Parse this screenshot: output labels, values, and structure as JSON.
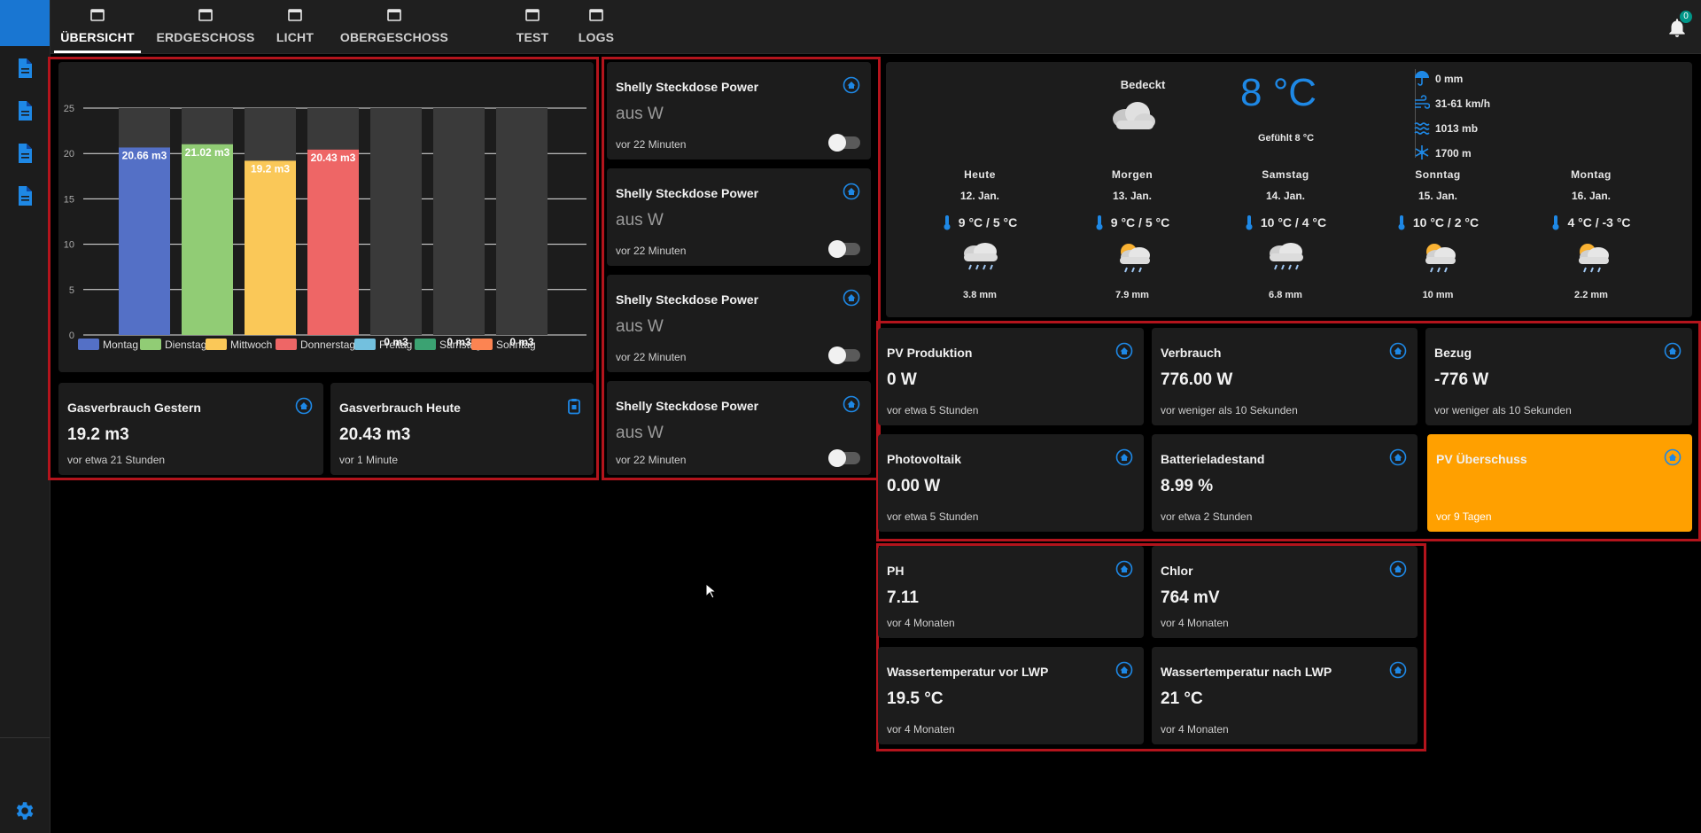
{
  "nav": {
    "tabs": [
      {
        "label": "ÜBERSICHT"
      },
      {
        "label": "ERDGESCHOSS"
      },
      {
        "label": "LICHT"
      },
      {
        "label": "OBERGESCHOSS"
      },
      {
        "label": "TEST"
      },
      {
        "label": "LOGS"
      }
    ],
    "notification_count": "0"
  },
  "colors": {
    "accent": "#1e88e5",
    "highlight_card": "#ffa000",
    "frame": "#b3141c"
  },
  "chart_data": {
    "type": "bar",
    "categories": [
      "Montag",
      "Dienstag",
      "Mittwoch",
      "Donnerstag",
      "Freitag",
      "Samstag",
      "Sonntag"
    ],
    "values": [
      20.66,
      21.02,
      19.2,
      20.43,
      0,
      0,
      0
    ],
    "data_labels": [
      "20.66 m3",
      "21.02 m3",
      "19.2 m3",
      "20.43 m3",
      "0 m3",
      "0 m3",
      "0 m3"
    ],
    "colors": [
      "#5470c6",
      "#91cc75",
      "#fac858",
      "#ee6666",
      "#73c0de",
      "#3ba272",
      "#fc8452"
    ],
    "yticks": [
      "0",
      "5",
      "10",
      "15",
      "20",
      "25"
    ],
    "ylim": [
      0,
      25
    ],
    "legend": [
      "Montag",
      "Dienstag",
      "Mittwoch",
      "Donnerstag",
      "Freitag",
      "Samstag",
      "Sonntag"
    ],
    "legend_position": "bottom",
    "grid": true
  },
  "gas": {
    "yesterday": {
      "name": "Gasverbrauch Gestern",
      "value": "19.2 m3",
      "time": "vor etwa 21 Stunden"
    },
    "today": {
      "name": "Gasverbrauch Heute",
      "value": "20.43 m3",
      "time": "vor 1 Minute"
    }
  },
  "shelly": [
    {
      "name": "Shelly Steckdose Power",
      "value": "aus W",
      "time": "vor 22 Minuten"
    },
    {
      "name": "Shelly Steckdose Power",
      "value": "aus W",
      "time": "vor 22 Minuten"
    },
    {
      "name": "Shelly Steckdose Power",
      "value": "aus W",
      "time": "vor 22 Minuten"
    },
    {
      "name": "Shelly Steckdose Power",
      "value": "aus W",
      "time": "vor 22 Minuten"
    }
  ],
  "weather": {
    "condition": "Bedeckt",
    "temperature": "8 °C",
    "feels_like": "Gefühlt 8 °C",
    "precipitation": "0 mm",
    "wind": "31-61 km/h",
    "pressure": "1013 mb",
    "altitude": "1700 m",
    "forecast": [
      {
        "day": "Heute",
        "date": "12. Jan.",
        "temps": "9 °C / 5 °C",
        "precip": "3.8 mm",
        "icon": "rain-icon"
      },
      {
        "day": "Morgen",
        "date": "13. Jan.",
        "temps": "9 °C / 5 °C",
        "precip": "7.9 mm",
        "icon": "sun-rain-icon"
      },
      {
        "day": "Samstag",
        "date": "14. Jan.",
        "temps": "10 °C / 4 °C",
        "precip": "6.8 mm",
        "icon": "rain-icon"
      },
      {
        "day": "Sonntag",
        "date": "15. Jan.",
        "temps": "10 °C / 2 °C",
        "precip": "10 mm",
        "icon": "sun-rain-icon"
      },
      {
        "day": "Montag",
        "date": "16. Jan.",
        "temps": "4 °C / -3 °C",
        "precip": "2.2 mm",
        "icon": "sun-rain-icon"
      }
    ]
  },
  "energy": [
    {
      "name": "PV Produktion",
      "value": "0 W",
      "time": "vor etwa 5 Stunden"
    },
    {
      "name": "Verbrauch",
      "value": "776.00 W",
      "time": "vor weniger als 10 Sekunden"
    },
    {
      "name": "Bezug",
      "value": "-776 W",
      "time": "vor weniger als 10 Sekunden"
    },
    {
      "name": "Photovoltaik",
      "value": "0.00 W",
      "time": "vor etwa 5 Stunden"
    },
    {
      "name": "Batterieladestand",
      "value": "8.99 %",
      "time": "vor etwa 2 Stunden"
    },
    {
      "name": "PV Überschuss",
      "value": "",
      "time": "vor 9 Tagen"
    }
  ],
  "pool": [
    {
      "name": "PH",
      "value": "7.11",
      "time": "vor 4 Monaten"
    },
    {
      "name": "Chlor",
      "value": "764 mV",
      "time": "vor 4 Monaten"
    },
    {
      "name": "Wassertemperatur vor LWP",
      "value": "19.5 °C",
      "time": "vor 4 Monaten"
    },
    {
      "name": "Wassertemperatur nach LWP",
      "value": "21 °C",
      "time": "vor 4 Monaten"
    }
  ]
}
